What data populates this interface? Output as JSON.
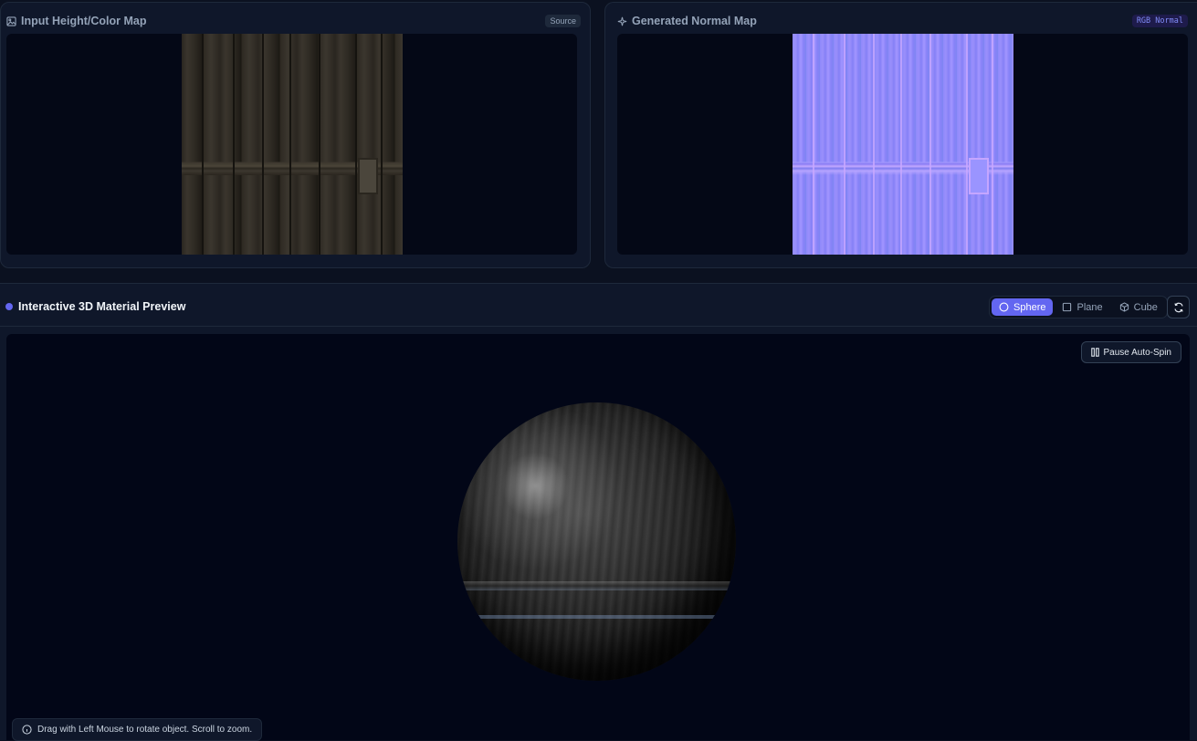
{
  "input_panel": {
    "title": "Input Height/Color Map",
    "badge": "Source",
    "icon": "image-icon"
  },
  "normal_panel": {
    "title": "Generated Normal Map",
    "badge": "RGB Normal",
    "icon": "sparkle-icon"
  },
  "preview": {
    "title": "Interactive 3D Material Preview",
    "shapes": [
      {
        "label": "Sphere",
        "icon": "circle-icon",
        "active": true
      },
      {
        "label": "Plane",
        "icon": "square-icon",
        "active": false
      },
      {
        "label": "Cube",
        "icon": "cube-icon",
        "active": false
      }
    ],
    "pause_label": "Pause Auto-Spin",
    "hint": "Drag with Left Mouse to rotate object. Scroll to zoom."
  },
  "colors": {
    "accent": "#6366f1",
    "background": "#0b1120",
    "panel": "#0f172a",
    "viewport": "#020617"
  }
}
